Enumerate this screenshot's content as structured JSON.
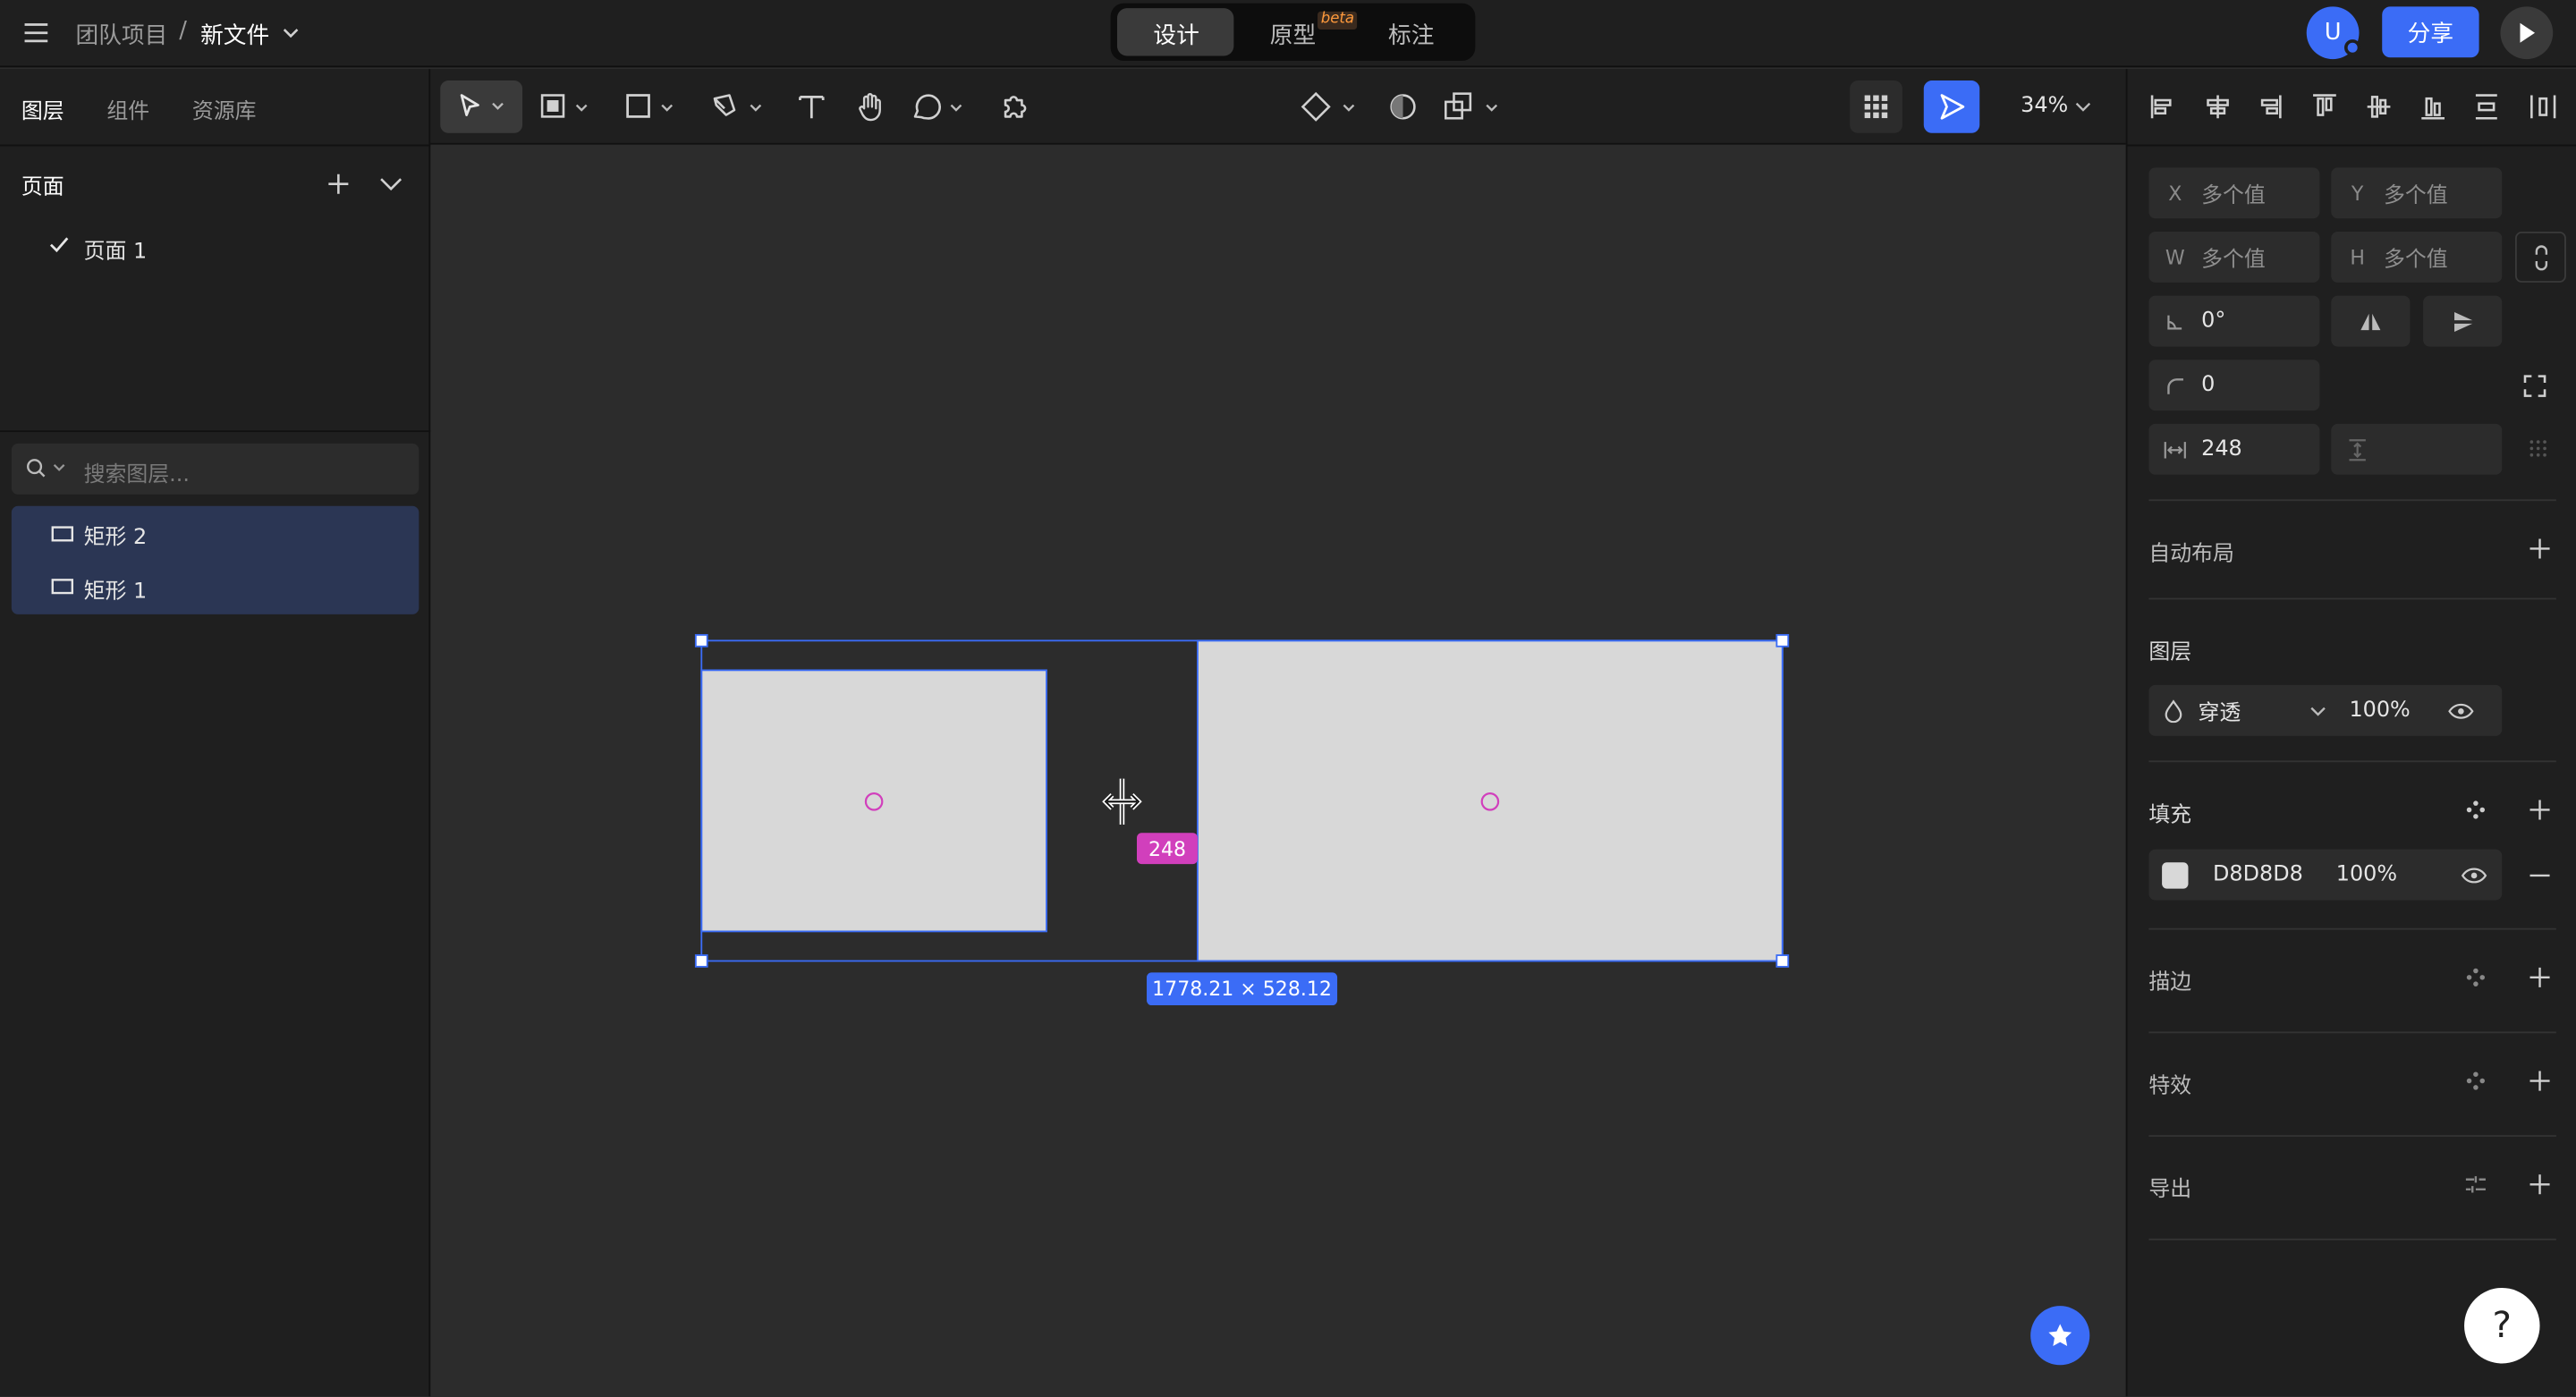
{
  "header": {
    "breadcrumb_team": "团队项目",
    "breadcrumb_sep": "/",
    "file_name": "新文件",
    "mode_tabs": [
      "设计",
      "原型",
      "标注"
    ],
    "beta_badge": "beta",
    "avatar_letter": "U",
    "share_label": "分享"
  },
  "left_panel": {
    "tabs": [
      "图层",
      "组件",
      "资源库"
    ],
    "pages_title": "页面",
    "pages": [
      "页面 1"
    ],
    "search_placeholder": "搜索图层...",
    "layers": [
      "矩形 2",
      "矩形 1"
    ]
  },
  "toolbar": {
    "zoom": "34%"
  },
  "canvas": {
    "gap_label": "248",
    "selection_size": "1778.21 × 528.12",
    "colors": {
      "rect_fill": "#d8d8d8",
      "selection": "#3b6cf6",
      "gap_badge": "#d13fbc"
    }
  },
  "right_panel": {
    "x_label": "X",
    "x_value": "多个值",
    "y_label": "Y",
    "y_value": "多个值",
    "w_label": "W",
    "w_value": "多个值",
    "h_label": "H",
    "h_value": "多个值",
    "rotation": "0°",
    "corner_radius": "0",
    "spacing": "248",
    "auto_layout": "自动布局",
    "layer_title": "图层",
    "blend_mode": "穿透",
    "layer_opacity": "100%",
    "fill_title": "填充",
    "fill_hex": "D8D8D8",
    "fill_opacity": "100%",
    "stroke_title": "描边",
    "effects_title": "特效",
    "export_title": "导出"
  },
  "help_label": "?"
}
